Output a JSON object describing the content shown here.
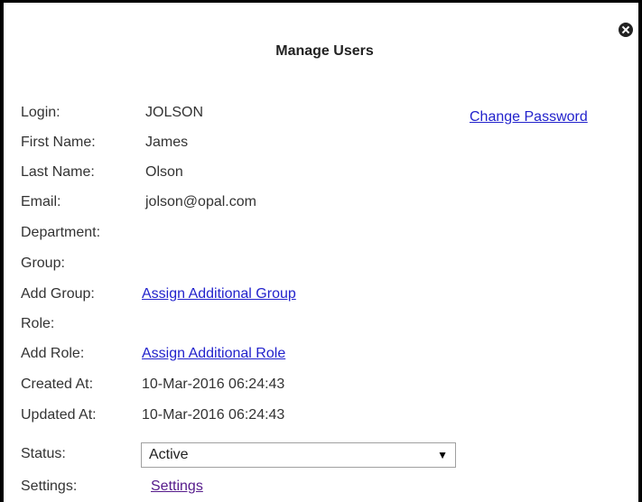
{
  "dialog": {
    "title": "Manage Users",
    "close_icon": "close-icon",
    "change_password": "Change Password"
  },
  "fields": {
    "login": {
      "label": "Login:",
      "value": "JOLSON"
    },
    "first_name": {
      "label": "First Name:",
      "value": "James"
    },
    "last_name": {
      "label": "Last Name:",
      "value": "Olson"
    },
    "email": {
      "label": "Email:",
      "value": "jolson@opal.com"
    },
    "department": {
      "label": "Department:",
      "value": ""
    },
    "group": {
      "label": "Group:",
      "value": ""
    },
    "add_group": {
      "label": "Add Group:",
      "link": "Assign Additional Group"
    },
    "role": {
      "label": "Role:",
      "value": ""
    },
    "add_role": {
      "label": "Add Role:",
      "link": "Assign Additional Role"
    },
    "created_at": {
      "label": "Created At:",
      "value": "10-Mar-2016 06:24:43"
    },
    "updated_at": {
      "label": "Updated At:",
      "value": "10-Mar-2016 06:24:43"
    },
    "status": {
      "label": "Status:",
      "selected": "Active",
      "arrow_icon": "dropdown-arrow-icon"
    },
    "settings": {
      "label": "Settings:",
      "link": "Settings"
    }
  }
}
